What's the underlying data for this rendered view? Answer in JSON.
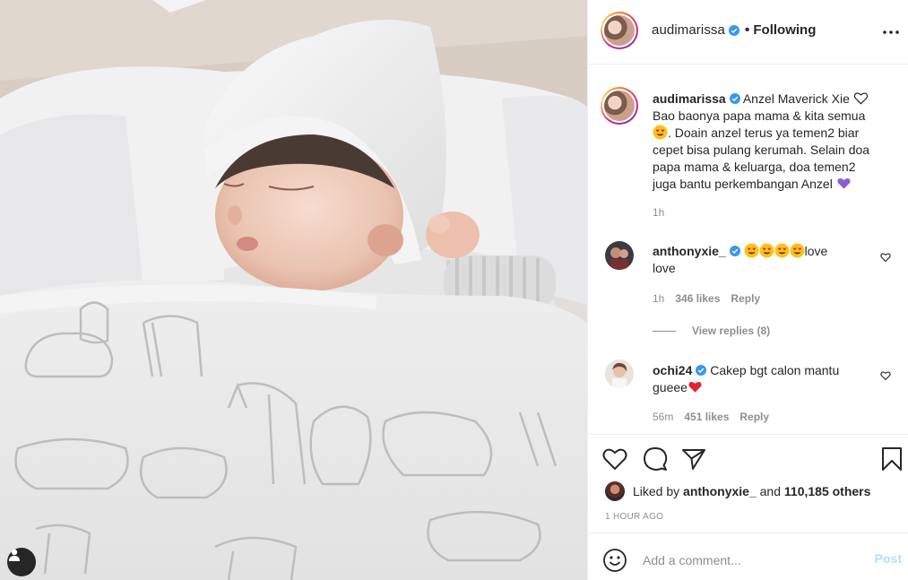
{
  "post": {
    "author": "audimarissa",
    "follow_status": "• Following",
    "caption_lines": [
      "Bao baonya papa mama & kita semua",
      ". Doain anzel terus ya temen2 biar",
      "cepet bisa pulang kerumah. Selain doa",
      "papa mama & keluarga, doa temen2",
      "juga bantu perkembangan Anzel"
    ],
    "caption_first": "Anzel Maverick Xie",
    "caption_time": "1h"
  },
  "comments": [
    {
      "user": "anthonyxie_",
      "text_end": "love",
      "text_line2": "love",
      "time": "1h",
      "likes": "346 likes",
      "reply": "Reply",
      "view_replies": "View replies (8)"
    },
    {
      "user": "ochi24",
      "text": "Cakep bgt calon mantu",
      "text_line2": "gueee",
      "time": "56m",
      "likes": "451 likes",
      "reply": "Reply"
    }
  ],
  "likes": {
    "liked_by_prefix": "Liked by",
    "liked_by_user": "anthonyxie_",
    "and": "and",
    "others": "110,185 others"
  },
  "timestamp": "1 HOUR AGO",
  "add_comment": {
    "placeholder": "Add a comment...",
    "post_label": "Post"
  },
  "icons": {
    "heart": "heart-icon",
    "comment": "comment-icon",
    "share": "share-icon",
    "save": "bookmark-icon",
    "more": "more-icon",
    "emoji": "smile-icon",
    "user_tag": "user-tag-icon"
  },
  "colors": {
    "verified": "#3897f0",
    "post_disabled": "#b2dffc",
    "meta_text": "#8e8e8e"
  }
}
